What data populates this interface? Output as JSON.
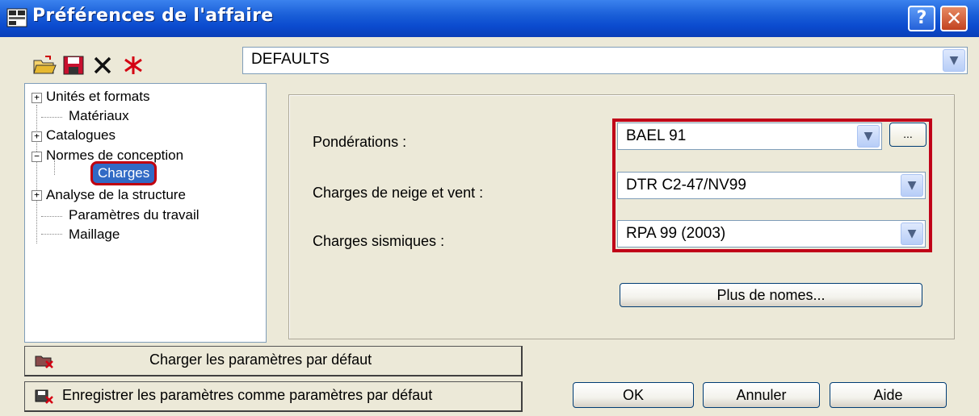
{
  "window": {
    "title": "Préférences de l'affaire",
    "help_icon": "?",
    "close_icon": "✕"
  },
  "toolbar": {
    "icons": [
      "open-folder-icon",
      "save-icon",
      "delete-icon",
      "delete-all-icon"
    ]
  },
  "preset_combo": {
    "value": "DEFAULTS",
    "arrow": "▼"
  },
  "tree": {
    "items": [
      {
        "label": "Unités et formats",
        "expander": "+"
      },
      {
        "label": "Matériaux"
      },
      {
        "label": "Catalogues",
        "expander": "+"
      },
      {
        "label": "Normes de conception",
        "expander": "−"
      },
      {
        "label": "Charges",
        "selected": true
      },
      {
        "label": "Analyse de la structure",
        "expander": "+"
      },
      {
        "label": "Paramètres du travail"
      },
      {
        "label": "Maillage"
      }
    ]
  },
  "form": {
    "ponderations": {
      "label": "Pondérations :",
      "value": "BAEL 91",
      "more": "..."
    },
    "neige_vent": {
      "label": "Charges de neige et vent :",
      "value": "DTR C2-47/NV99"
    },
    "sismiques": {
      "label": "Charges sismiques :",
      "value": "RPA 99 (2003)"
    },
    "more_norms": "Plus de nomes..."
  },
  "buttons": {
    "load_defaults": "Charger les paramètres par défaut",
    "save_defaults": "Enregistrer les paramètres comme paramètres par défaut",
    "ok": "OK",
    "cancel": "Annuler",
    "help": "Aide"
  },
  "colors": {
    "title_bar": "#0b4bcf",
    "highlight": "#c00018",
    "selection": "#316ac5"
  }
}
